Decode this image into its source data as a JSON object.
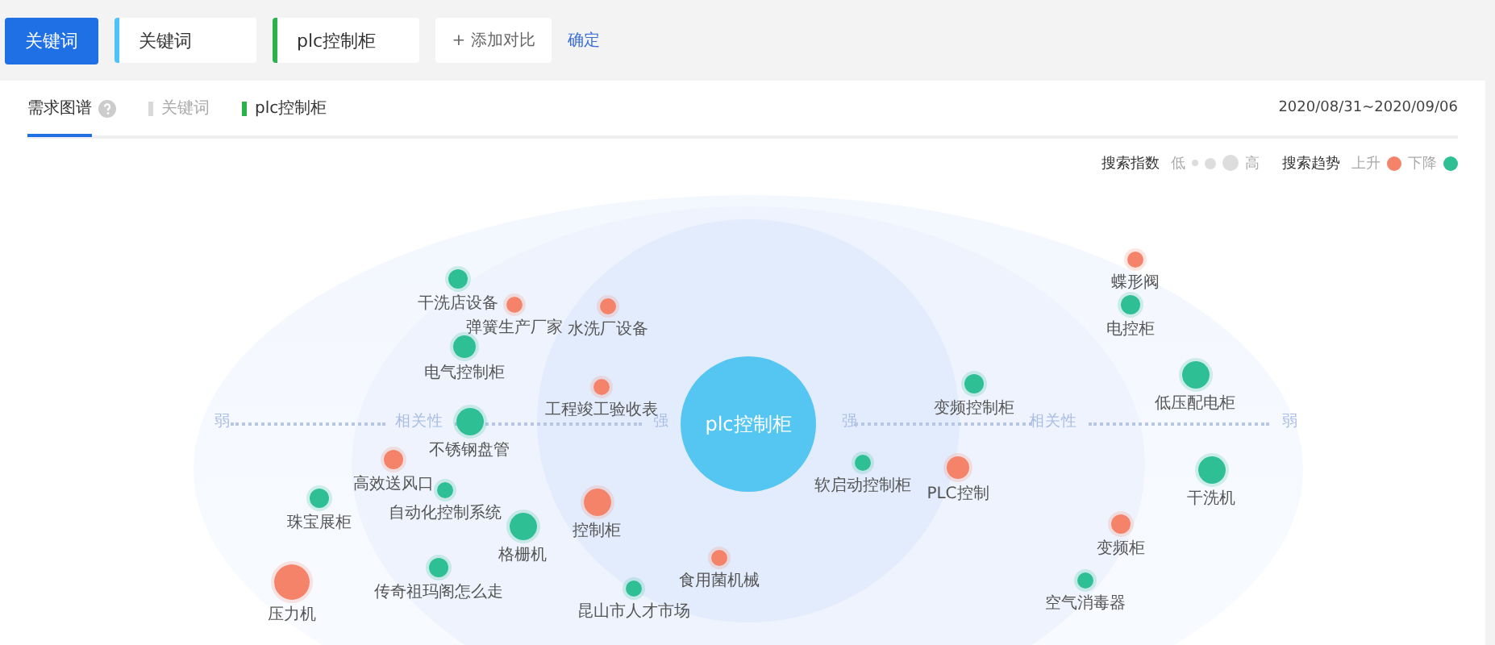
{
  "toolbar": {
    "mode_button": "关键词",
    "keyword_fields": [
      {
        "value": "关键词",
        "color": "#4fc3f7"
      },
      {
        "value": "plc控制柜",
        "color": "#2bb24c"
      }
    ],
    "add_button": "+ 添加对比",
    "confirm_link": "确定"
  },
  "tabs": [
    {
      "label": "需求图谱",
      "selected": true
    }
  ],
  "series_tabs": [
    {
      "label": "关键词",
      "color": "#d9d9d9",
      "enabled": false
    },
    {
      "label": "plc控制柜",
      "color": "#2bb24c",
      "enabled": true
    }
  ],
  "date_range": "2020/08/31~2020/09/06",
  "legend": {
    "index_label": "搜索指数",
    "low": "低",
    "high": "高",
    "trend_label": "搜索趋势",
    "up": "上升",
    "down": "下降"
  },
  "chart": {
    "center": "plc控制柜",
    "axis_labels": [
      "弱",
      "相关性",
      "强",
      "强",
      "相关性",
      "弱"
    ],
    "nodes": [
      {
        "label": "干洗店设备",
        "color": "#2fbf94",
        "kind": "small"
      },
      {
        "label": "弹簧生产厂家",
        "color": "#f5836a",
        "kind": "tiny"
      },
      {
        "label": "水洗厂设备",
        "color": "#f5836a",
        "kind": "tiny"
      },
      {
        "label": "电气控制柜",
        "color": "#2fbf94",
        "kind": "medium"
      },
      {
        "label": "工程竣工验收表",
        "color": "#f5836a",
        "kind": "tiny"
      },
      {
        "label": "不锈钢盘管",
        "color": "#2fbf94",
        "kind": "large"
      },
      {
        "label": "高效送风口",
        "color": "#f5836a",
        "kind": "small"
      },
      {
        "label": "自动化控制系统",
        "color": "#2fbf94",
        "kind": "tiny"
      },
      {
        "label": "珠宝展柜",
        "color": "#2fbf94",
        "kind": "small"
      },
      {
        "label": "格栅机",
        "color": "#2fbf94",
        "kind": "large"
      },
      {
        "label": "控制柜",
        "color": "#f5836a",
        "kind": "large"
      },
      {
        "label": "压力机",
        "color": "#f5836a",
        "kind": "huge"
      },
      {
        "label": "传奇祖玛阁怎么走",
        "color": "#2fbf94",
        "kind": "small"
      },
      {
        "label": "昆山市人才市场",
        "color": "#2fbf94",
        "kind": "tiny"
      },
      {
        "label": "食用菌机械",
        "color": "#f5836a",
        "kind": "tiny"
      },
      {
        "label": "软启动控制柜",
        "color": "#2fbf94",
        "kind": "tiny"
      },
      {
        "label": "变频控制柜",
        "color": "#2fbf94",
        "kind": "small"
      },
      {
        "label": "PLC控制",
        "color": "#f5836a",
        "kind": "medium"
      },
      {
        "label": "蝶形阀",
        "color": "#f5836a",
        "kind": "tiny"
      },
      {
        "label": "电控柜",
        "color": "#2fbf94",
        "kind": "small"
      },
      {
        "label": "低压配电柜",
        "color": "#2fbf94",
        "kind": "large"
      },
      {
        "label": "干洗机",
        "color": "#2fbf94",
        "kind": "large"
      },
      {
        "label": "变频柜",
        "color": "#f5836a",
        "kind": "small"
      },
      {
        "label": "空气消毒器",
        "color": "#2fbf94",
        "kind": "tiny"
      }
    ]
  }
}
